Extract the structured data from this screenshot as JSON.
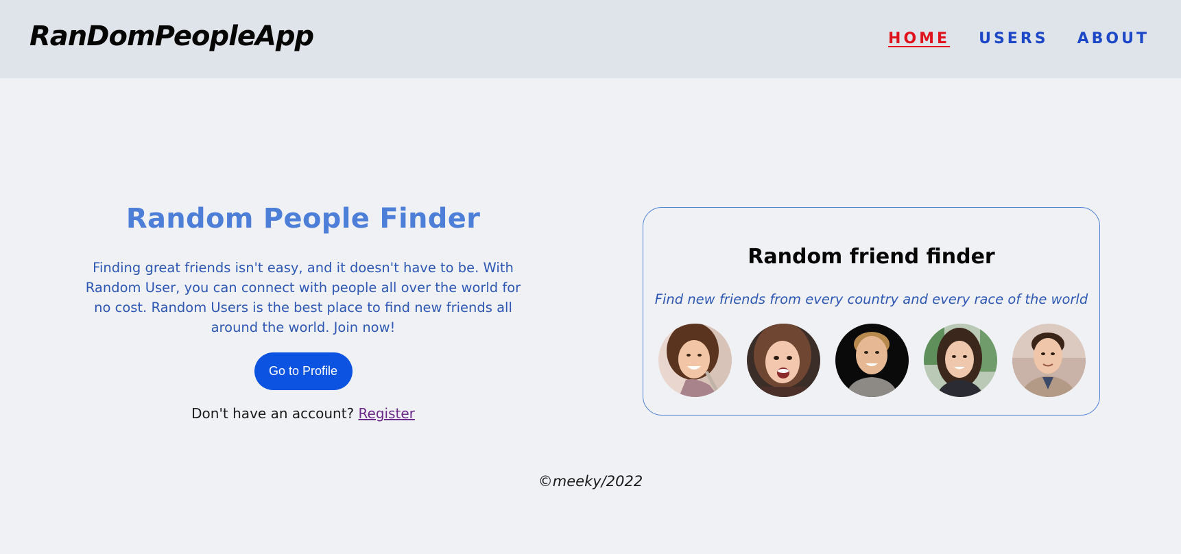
{
  "brand": "RanDomPeopleApp",
  "nav": {
    "links": [
      {
        "label": "HOME",
        "active": true
      },
      {
        "label": "USERS",
        "active": false
      },
      {
        "label": "ABOUT",
        "active": false
      }
    ]
  },
  "hero": {
    "title": "Random People Finder",
    "description": "Finding great friends isn't easy, and it doesn't have to be. With Random User, you can connect with people all over the world for no cost. Random Users is the best place to find new friends all around the world. Join now!",
    "button_label": "Go to Profile",
    "register_prompt": "Don't have an account?",
    "register_link": "Register"
  },
  "card": {
    "title": "Random friend finder",
    "subtitle": "Find new friends from every country and every race of the world"
  },
  "footer": {
    "copyright": "©meeky/2022"
  },
  "colors": {
    "navbar_bg": "#dfe3ea",
    "page_bg": "#f0f1f5",
    "nav_link": "#1c47c6",
    "nav_active": "#e0141c",
    "accent_blue": "#4d7fd9",
    "button_bg": "#0b53e0",
    "card_border": "#4a7fd4"
  }
}
